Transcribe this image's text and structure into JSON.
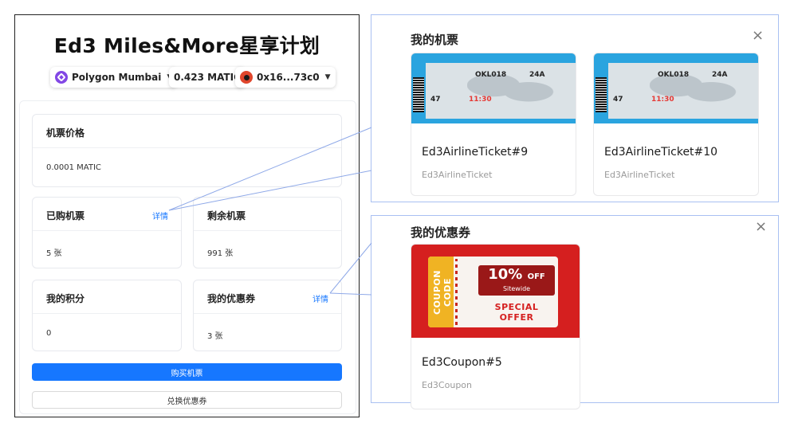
{
  "app": {
    "title": "Ed3 Miles&More星享计划",
    "network": {
      "label": "Polygon Mumbai",
      "icon": "polygon-icon"
    },
    "balance": "0.423 MATIC",
    "account": {
      "label": "0x16...73c0",
      "icon": "avatar-icon"
    }
  },
  "cards": {
    "price": {
      "label": "机票价格",
      "value": "0.0001 MATIC"
    },
    "purchased": {
      "label": "已购机票",
      "detail": "详情",
      "value": "5 张"
    },
    "remaining": {
      "label": "剩余机票",
      "value": "991 张"
    },
    "points": {
      "label": "我的积分",
      "value": "0"
    },
    "coupons": {
      "label": "我的优惠券",
      "detail": "详情",
      "value": "3 张"
    }
  },
  "buttons": {
    "buy": "购买机票",
    "redeem": "兑换优惠券"
  },
  "tickets_modal": {
    "title": "我的机票",
    "close": "×",
    "items": [
      {
        "name": "Ed3AirlineTicket#9",
        "collection": "Ed3AirlineTicket"
      },
      {
        "name": "Ed3AirlineTicket#10",
        "collection": "Ed3AirlineTicket"
      }
    ],
    "ticket_image": {
      "flight": "OKL018",
      "seat": "24A",
      "gate": "47",
      "time": "11:30"
    }
  },
  "coupons_modal": {
    "title": "我的优惠券",
    "close": "×",
    "items": [
      {
        "name": "Ed3Coupon#5",
        "collection": "Ed3Coupon"
      }
    ],
    "coupon_image": {
      "stub": "COUPON CODE",
      "discount": "10%",
      "off": "OFF",
      "scope": "Sitewide",
      "offer": "SPECIAL OFFER"
    }
  },
  "colors": {
    "primary": "#1677ff",
    "connector": "#8fa9e8",
    "ticket_blue": "#2aa4df",
    "coupon_red": "#d51f1f"
  }
}
